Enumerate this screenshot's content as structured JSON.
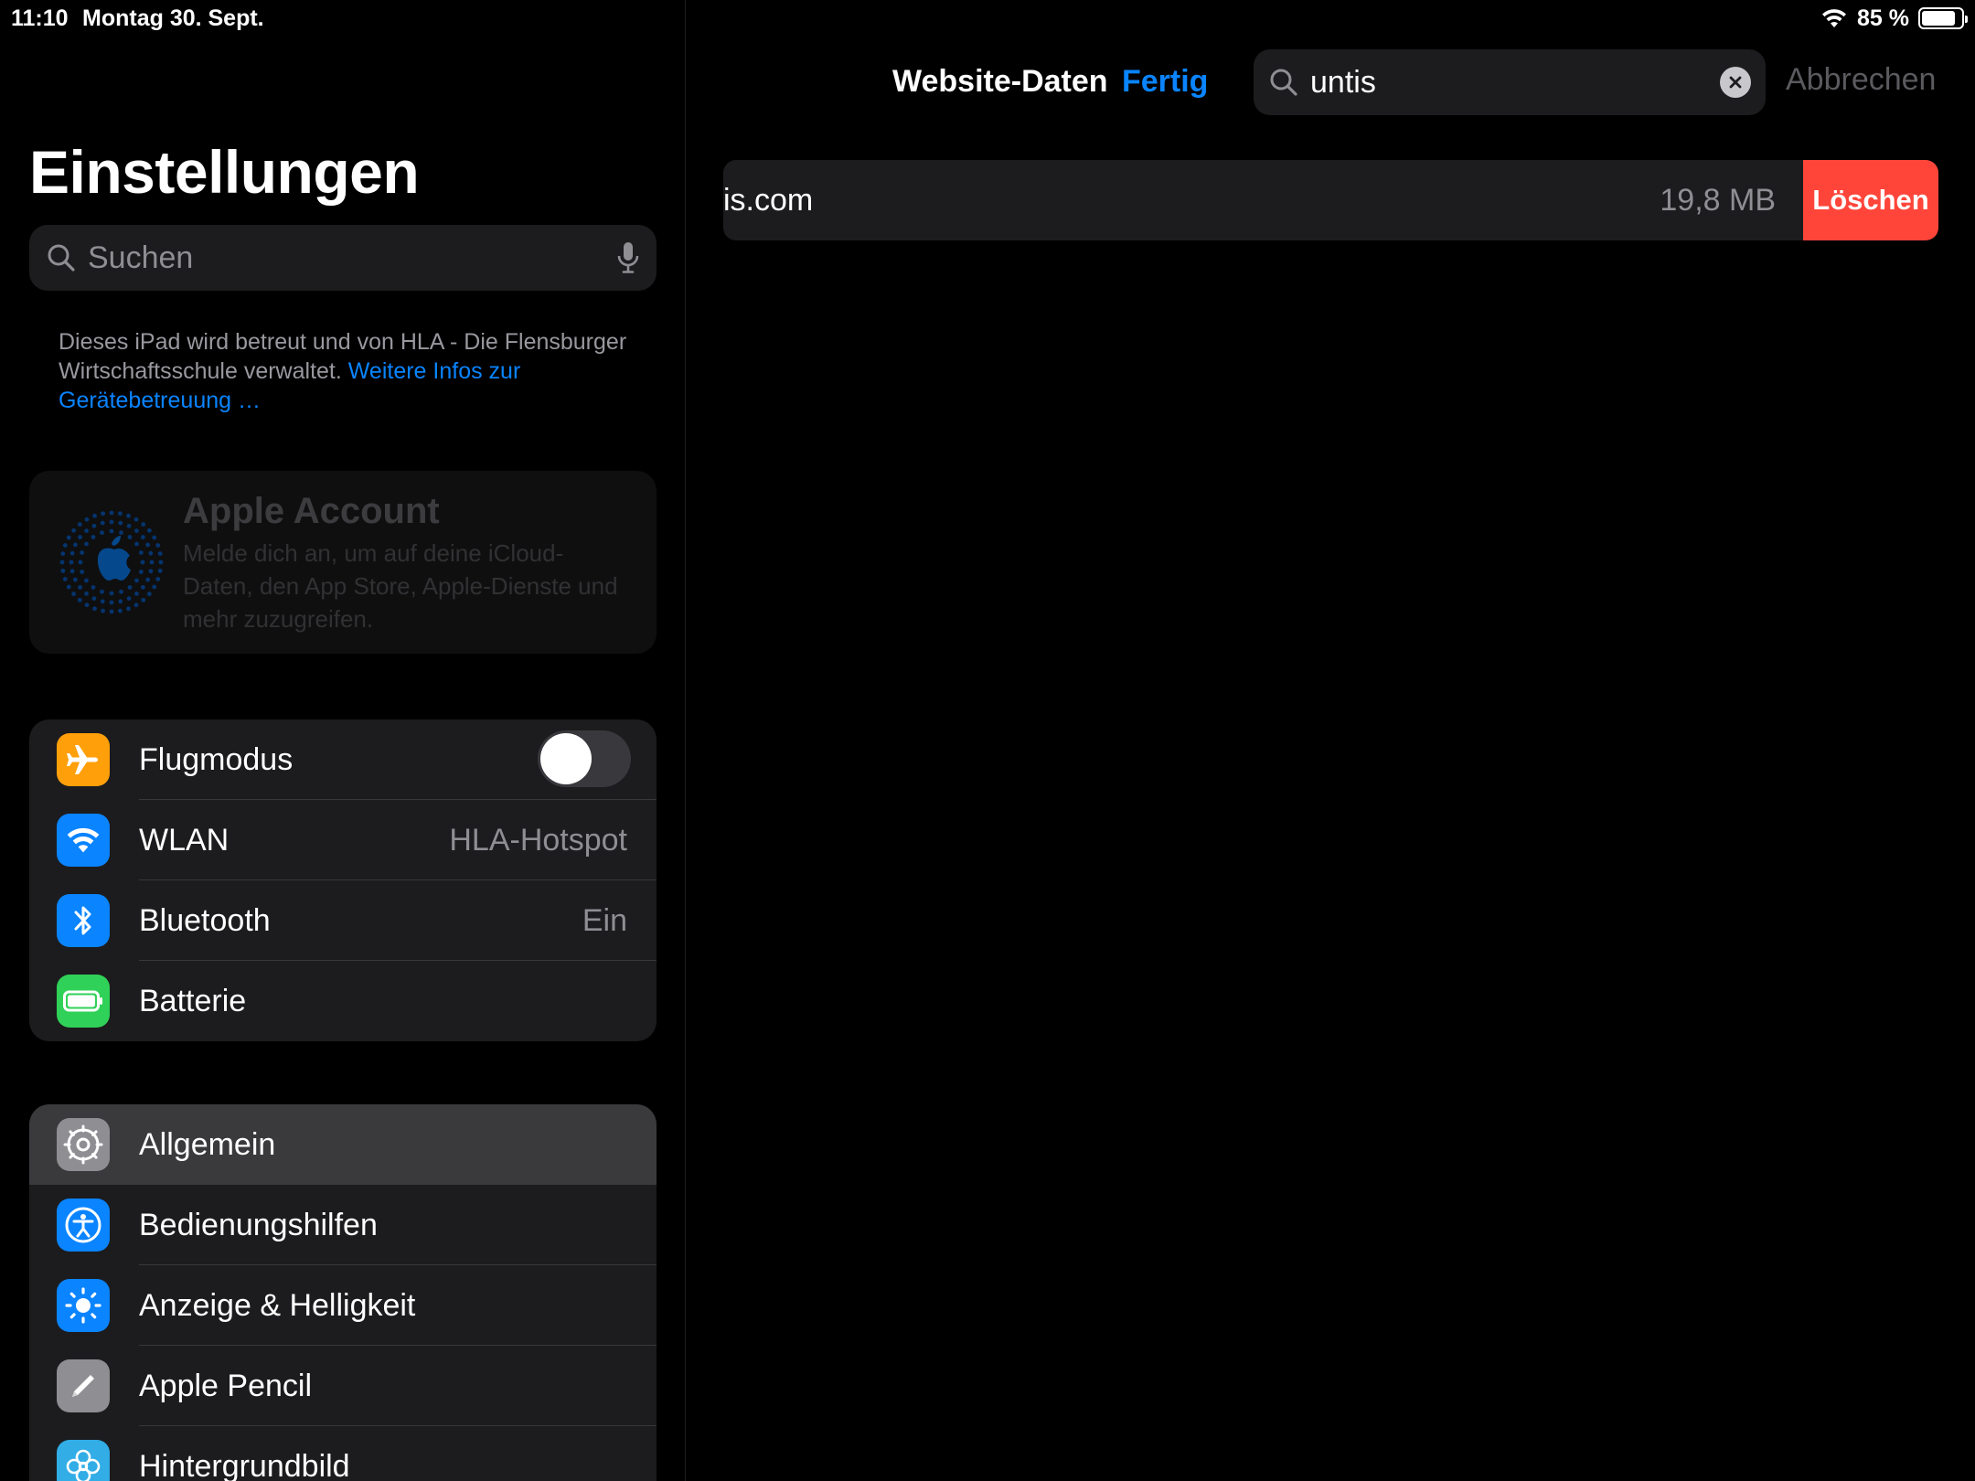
{
  "status_bar": {
    "time": "11:10",
    "date": "Montag 30. Sept.",
    "battery_percent": "85 %",
    "battery_level": 0.85
  },
  "sidebar": {
    "title": "Einstellungen",
    "search_placeholder": "Suchen",
    "mdm_note": {
      "text": "Dieses iPad wird betreut und von HLA - Die Flensburger Wirtschaftsschule verwaltet. ",
      "link": "Weitere Infos zur Gerätebetreuung …"
    },
    "account": {
      "title": "Apple Account",
      "description": "Melde dich an, um auf deine iCloud-Daten, den App Store, Apple-Dienste und mehr zuzugreifen."
    },
    "group1": [
      {
        "label": "Flugmodus",
        "icon": "airplane-icon",
        "color": "#ff9f0a",
        "toggle": false
      },
      {
        "label": "WLAN",
        "value": "HLA-Hotspot",
        "icon": "wifi-icon",
        "color": "#0a84ff"
      },
      {
        "label": "Bluetooth",
        "value": "Ein",
        "icon": "bluetooth-icon",
        "color": "#0a84ff"
      },
      {
        "label": "Batterie",
        "icon": "battery-icon",
        "color": "#30d158"
      }
    ],
    "group2": [
      {
        "label": "Allgemein",
        "icon": "gear-icon",
        "color": "#8e8e93",
        "selected": true
      },
      {
        "label": "Bedienungshilfen",
        "icon": "accessibility-icon",
        "color": "#0a84ff"
      },
      {
        "label": "Anzeige & Helligkeit",
        "icon": "brightness-icon",
        "color": "#0a84ff"
      },
      {
        "label": "Apple Pencil",
        "icon": "pencil-icon",
        "color": "#8e8e93"
      },
      {
        "label": "Hintergrundbild",
        "icon": "wallpaper-icon",
        "color": "#32ade6"
      }
    ]
  },
  "detail": {
    "nav_title": "Website-Daten",
    "done_label": "Fertig",
    "search_query": "untis",
    "cancel_label": "Abbrechen",
    "sites": [
      {
        "name": "is.com",
        "size": "19,8 MB",
        "delete_label": "Löschen"
      }
    ]
  }
}
